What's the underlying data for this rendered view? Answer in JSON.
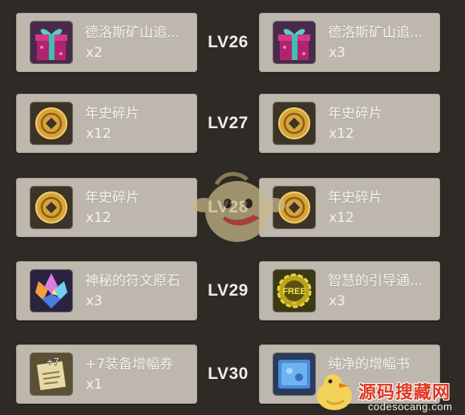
{
  "rows": [
    {
      "level": "LV26",
      "left": {
        "name": "德洛斯矿山追...",
        "qty": "x2",
        "icon": "gift-box-icon"
      },
      "right": {
        "name": "德洛斯矿山追...",
        "qty": "x3",
        "icon": "gift-box-icon"
      }
    },
    {
      "level": "LV27",
      "left": {
        "name": "年史碎片",
        "qty": "x12",
        "icon": "coin-fragment-icon"
      },
      "right": {
        "name": "年史碎片",
        "qty": "x12",
        "icon": "coin-fragment-icon"
      }
    },
    {
      "level": "LV28",
      "left": {
        "name": "年史碎片",
        "qty": "x12",
        "icon": "coin-fragment-icon"
      },
      "right": {
        "name": "年史碎片",
        "qty": "x12",
        "icon": "coin-fragment-icon"
      }
    },
    {
      "level": "LV29",
      "left": {
        "name": "神秘的符文原石",
        "qty": "x3",
        "icon": "rune-crystal-icon"
      },
      "right": {
        "name": "智慧的引导通...",
        "qty": "x3",
        "icon": "free-gear-icon"
      }
    },
    {
      "level": "LV30",
      "left": {
        "name": "+7装备增幅券",
        "qty": "x1",
        "icon": "scroll-plus7-icon"
      },
      "right": {
        "name": "纯净的增幅书",
        "qty": "",
        "icon": "blue-book-icon"
      }
    }
  ],
  "watermark": {
    "text": "源码搜藏网",
    "url": "codesocang.com"
  }
}
